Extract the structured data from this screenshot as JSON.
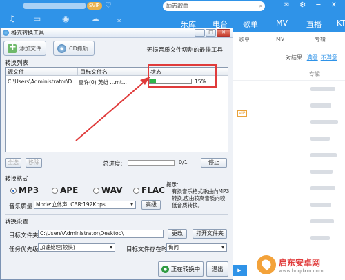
{
  "background_app": {
    "search_text": "励志歌曲",
    "svip_badge": "SVIP",
    "nav": [
      "乐库",
      "电台",
      "歌单",
      "MV",
      "直播",
      "KT"
    ],
    "sub_nav": [
      "歌单",
      "MV",
      "专辑"
    ],
    "filter_label": "对结果:",
    "filter_options": [
      "满意",
      "不满意"
    ],
    "column_album": "专辑"
  },
  "window": {
    "title": "格式转换工具",
    "toolbar": {
      "add_file": "添加文件",
      "cd_rip": "CD抓轨",
      "slogan": "无损音质文件切割的最佳工具"
    },
    "list": {
      "section_title": "转换列表",
      "columns": [
        "源文件",
        "目标文件名",
        "状态"
      ],
      "rows": [
        {
          "source": "C:\\Users\\Administrator\\D...",
          "target": "夏许(0) 英雄      ...mt...",
          "progress": 15,
          "progress_text": "15%"
        }
      ]
    },
    "buttons": {
      "select_all": "全选",
      "remove": "移除",
      "stop": "停止",
      "advanced": "高级",
      "change": "更改",
      "open_folder": "打开文件夹",
      "converting": "正在转换中",
      "exit": "退出"
    },
    "total_progress": {
      "label": "总进度:",
      "value": 0,
      "count": "0/1"
    },
    "format": {
      "section_title": "转换格式",
      "options": [
        "MP3",
        "APE",
        "WAV",
        "FLAC"
      ],
      "selected": "MP3",
      "quality_label": "音乐质量",
      "quality_value": "Mode:立体声, CBR:192Kbps",
      "tip_title": "提示:",
      "tip_body": "有损音乐格式歌曲向MP3转换,应由较高音质向较低音质转换。"
    },
    "settings": {
      "section_title": "转换设置",
      "target_folder_label": "目标文件夹",
      "target_folder_value": "C:\\Users\\Administrator\\Desktop\\",
      "priority_label": "任务优先级",
      "priority_value": "加速处理(较快)",
      "exists_label": "目标文件存在时",
      "exists_value": "询问"
    }
  },
  "watermark": {
    "name": "启东安卓网",
    "url": "www.hnqdxm.com"
  },
  "colors": {
    "accent_blue": "#2f93e8",
    "progress_green": "#2fb54a",
    "annotation_red": "#e03b3b"
  }
}
